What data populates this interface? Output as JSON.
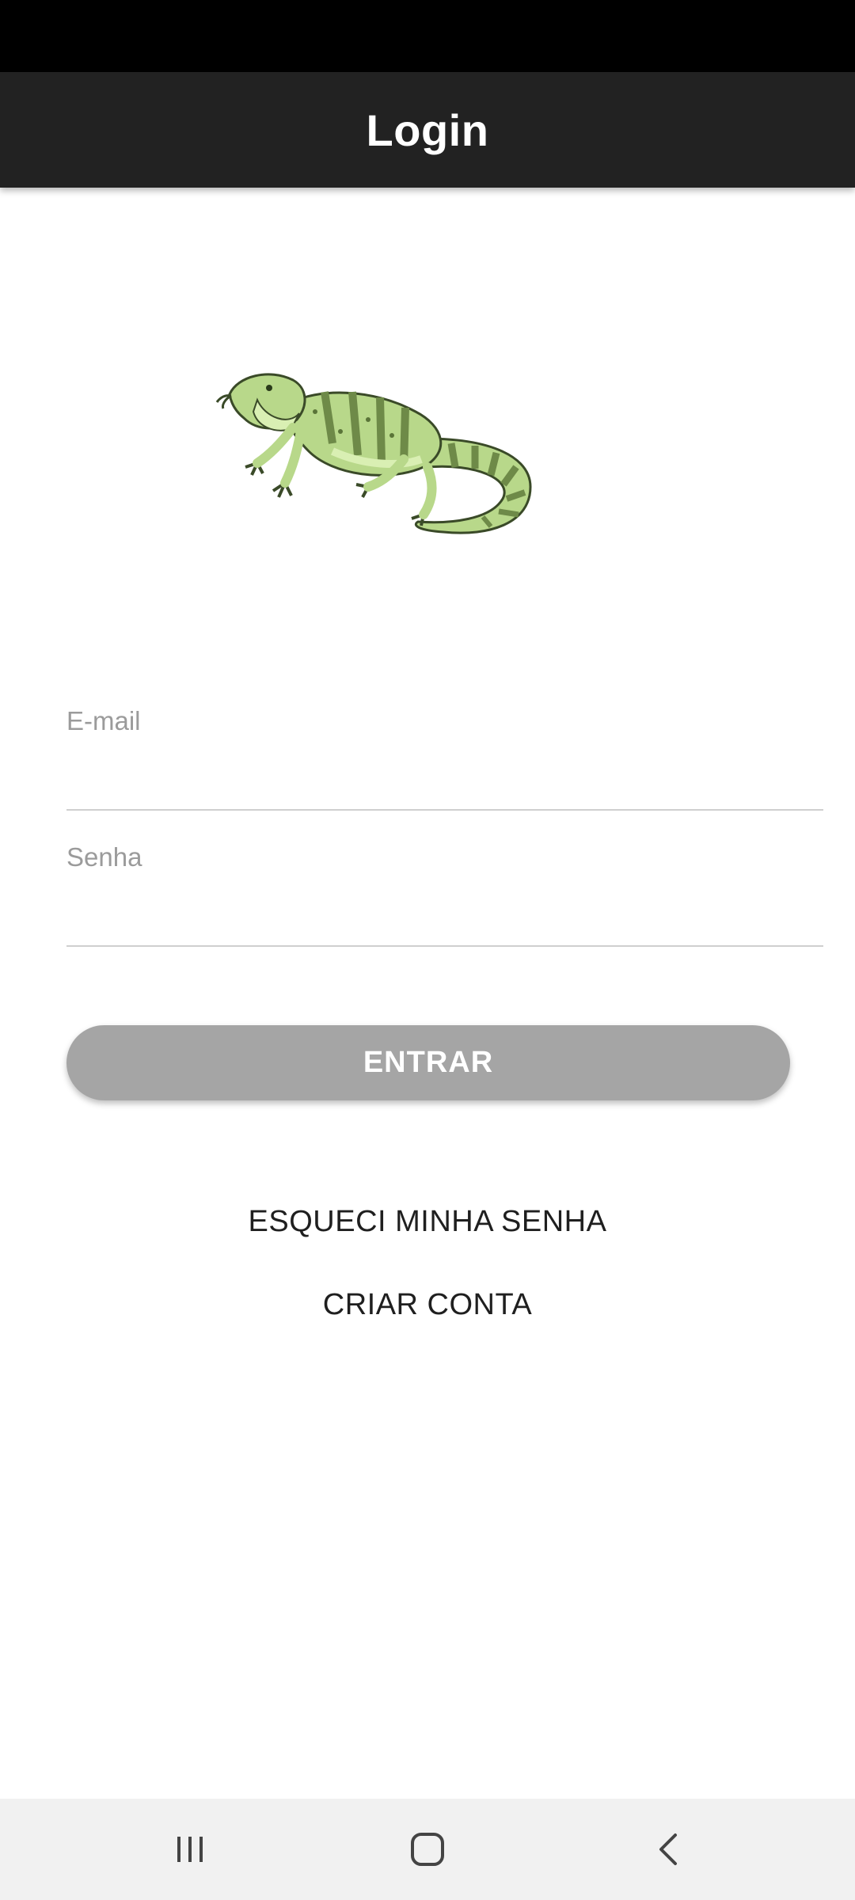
{
  "app_bar": {
    "title": "Login"
  },
  "logo": {
    "icon": "lizard-icon"
  },
  "form": {
    "email": {
      "label": "E-mail",
      "value": ""
    },
    "password": {
      "label": "Senha",
      "value": ""
    },
    "submit_label": "ENTRAR"
  },
  "links": {
    "forgot_password": "ESQUECI MINHA SENHA",
    "create_account": "CRIAR CONTA"
  },
  "navigation_bar": {
    "recents_icon": "recents-icon",
    "home_icon": "home-icon",
    "back_icon": "back-icon"
  },
  "colors": {
    "status_bar": "#000000",
    "app_bar": "#222222",
    "button_disabled": "#a5a5a5",
    "label": "#9b9b9b",
    "nav_bar": "#f1f1f1"
  }
}
